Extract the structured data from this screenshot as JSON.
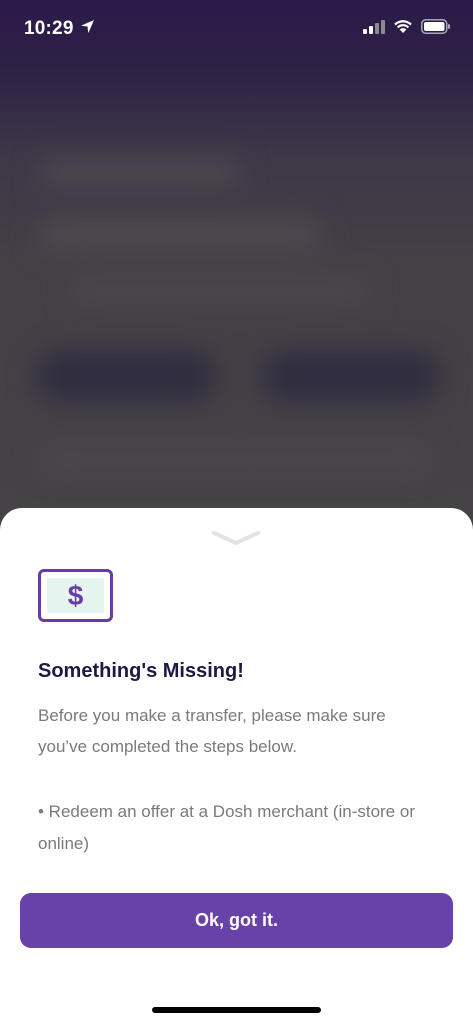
{
  "status_bar": {
    "time": "10:29",
    "location_icon": "location-arrow-icon",
    "signal_icon": "cellular-signal-icon",
    "wifi_icon": "wifi-icon",
    "battery_icon": "battery-icon"
  },
  "sheet": {
    "collapse_icon": "chevron-down-icon",
    "illustration_icon": "dollar-bill-icon",
    "illustration_glyph": "$",
    "title": "Something's Missing!",
    "body": "Before you make a transfer, please make sure you’ve completed the steps below.",
    "bullet": "• Redeem an offer at a Dosh merchant (in-store or online)",
    "ok_label": "Ok, got it."
  },
  "colors": {
    "accent": "#6841a9",
    "title": "#1f1842",
    "body": "#7a7a7a",
    "bill_bg": "#e6f4ef"
  }
}
